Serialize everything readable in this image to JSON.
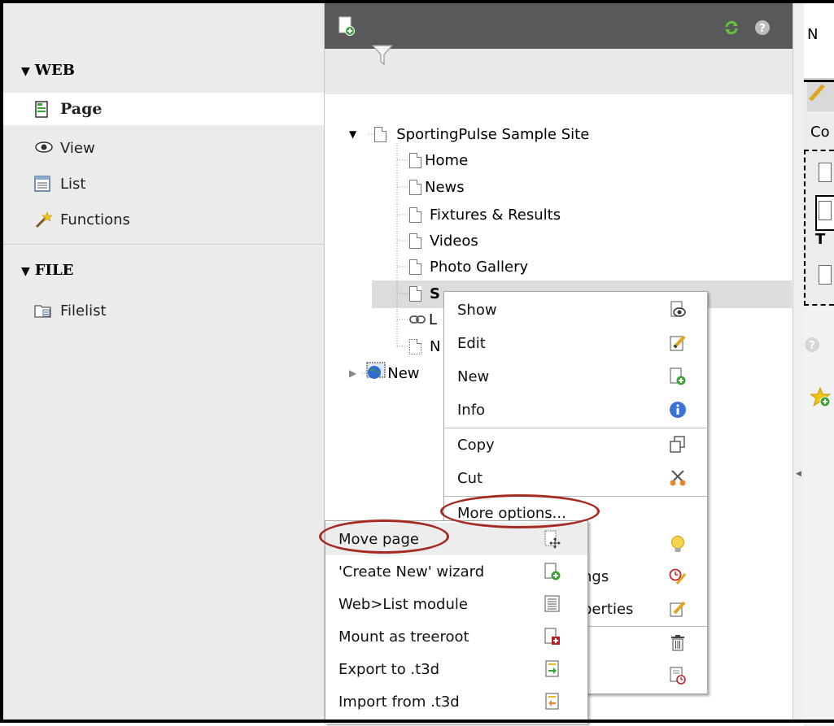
{
  "module_menu": {
    "web_group": "WEB",
    "file_group": "FILE",
    "web_items": [
      {
        "label": "Page",
        "icon": "page-icon",
        "active": true
      },
      {
        "label": "View",
        "icon": "eye-icon"
      },
      {
        "label": "List",
        "icon": "list-icon"
      },
      {
        "label": "Functions",
        "icon": "magic-wand-icon"
      }
    ],
    "file_items": [
      {
        "label": "Filelist",
        "icon": "filelist-icon"
      }
    ]
  },
  "tree": {
    "root": "SportingPulse Sample Site",
    "children": [
      "Home",
      "News",
      "Fixtures & Results",
      "Videos",
      "Photo Gallery"
    ],
    "selected_partial": "S",
    "link_partial": "L",
    "hidden_partial": "N",
    "second_root_partial": "New"
  },
  "context_menu": {
    "items_a": [
      {
        "label": "Show",
        "icon": "show-icon"
      },
      {
        "label": "Edit",
        "icon": "edit-icon"
      },
      {
        "label": "New",
        "icon": "new-page-icon"
      },
      {
        "label": "Info",
        "icon": "info-icon"
      }
    ],
    "items_b": [
      {
        "label": "Copy",
        "icon": "copy-icon"
      },
      {
        "label": "Cut",
        "icon": "cut-icon"
      }
    ],
    "more_options": "More options...",
    "partial_settings": "ngs",
    "partial_properties": "perties"
  },
  "submenu": {
    "items": [
      {
        "label": "Move page",
        "icon": "move-page-icon"
      },
      {
        "label": "'Create New' wizard",
        "icon": "create-wizard-icon"
      },
      {
        "label": "Web>List module",
        "icon": "list-module-icon"
      },
      {
        "label": "Mount as treeroot",
        "icon": "mount-icon"
      },
      {
        "label": "Export to .t3d",
        "icon": "export-icon"
      },
      {
        "label": "Import from .t3d",
        "icon": "import-icon"
      }
    ]
  },
  "right_panel": {
    "header_partial": "N",
    "content_partial": "Co",
    "bold_partial": "T"
  },
  "colors": {
    "annotation_oval": "#a42a22",
    "toolbar_bg": "#595959",
    "menu_bg": "#ebebeb"
  }
}
